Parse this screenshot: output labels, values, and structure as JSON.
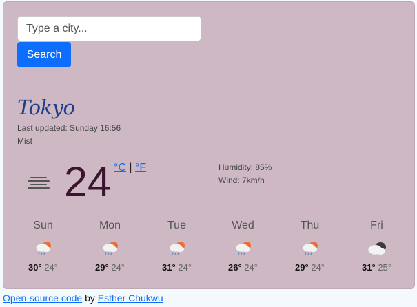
{
  "search": {
    "placeholder": "Type a city...",
    "value": "",
    "button_label": "Search"
  },
  "current": {
    "city": "Tokyo",
    "updated": "Last updated: Sunday 16:56",
    "condition": "Mist",
    "condition_icon": "mist-icon",
    "temperature": "24",
    "unit_celsius": "°C",
    "unit_separator": "|",
    "unit_fahrenheit": "°F",
    "humidity": "Humidity: 85%",
    "wind": "Wind: 7km/h"
  },
  "forecast": [
    {
      "day": "Sun",
      "icon": "light-rain-sun-icon",
      "max": "30°",
      "min": "24°"
    },
    {
      "day": "Mon",
      "icon": "light-rain-sun-icon",
      "max": "29°",
      "min": "24°"
    },
    {
      "day": "Tue",
      "icon": "light-rain-sun-icon",
      "max": "31°",
      "min": "24°"
    },
    {
      "day": "Wed",
      "icon": "light-rain-sun-icon",
      "max": "26°",
      "min": "24°"
    },
    {
      "day": "Thu",
      "icon": "light-rain-sun-icon",
      "max": "29°",
      "min": "24°"
    },
    {
      "day": "Fri",
      "icon": "cloudy-icon",
      "max": "31°",
      "min": "25°"
    }
  ],
  "footer": {
    "source_link": "Open-source code",
    "by_text": " by ",
    "author_link": "Esther Chukwu"
  },
  "colors": {
    "card_background": "#cdb8c4",
    "accent": "#0d6efd",
    "city_text": "#1e3f87",
    "temperature_text": "#3b1530"
  }
}
